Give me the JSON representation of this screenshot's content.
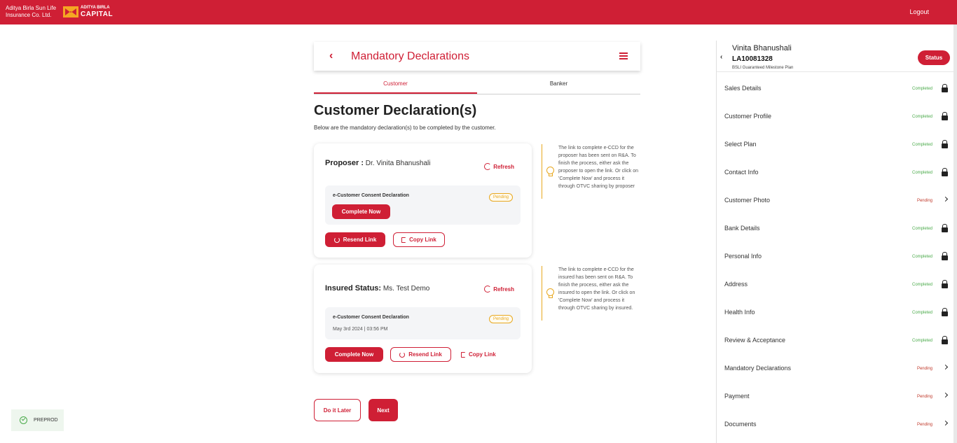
{
  "header": {
    "brand_line1": "Aditya Birla Sun Life",
    "brand_line2": "Insurance Co. Ltd.",
    "logo_top": "ADITYA BIRLA",
    "logo_bottom": "CAPITAL",
    "logout": "Logout",
    "accent_color": "#cf1f35"
  },
  "page": {
    "back_icon": "chevron-left-icon",
    "title": "Mandatory Declarations",
    "menu_icon": "hamburger-menu-icon"
  },
  "tabs": [
    {
      "label": "Customer",
      "active": true
    },
    {
      "label": "Banker",
      "active": false
    }
  ],
  "main": {
    "title": "Customer Declaration(s)",
    "subtitle": "Below are the mandatory declaration(s) to be completed by the customer."
  },
  "cards": [
    {
      "label": "Proposer :",
      "value": " Dr. Vinita Bhanushali",
      "refresh": "Refresh",
      "declaration": "e-Customer Consent Declaration",
      "badge": "Pending",
      "complete_now": "Complete Now",
      "resend_link": "Resend Link",
      "copy_link": "Copy Link",
      "hint": "The link to complete e-CCD for the proposer has been sent on R&A. To finish the process, either ask the proposer to open the link. Or click on 'Complete Now' and process it through OTVC sharing by proposer"
    },
    {
      "label": "Insured Status:",
      "value": " Ms. Test Demo",
      "refresh": "Refresh",
      "declaration": "e-Customer Consent Declaration",
      "date": "May 3rd 2024 | 03:56 PM",
      "badge": "Pending",
      "complete_now": "Complete Now",
      "resend_link": "Resend Link",
      "copy_link": "Copy Link",
      "hint": "The link to complete e-CCD for the insured has been sent on R&A. To finish the process, either ask the insured to open the link. Or click on 'Complete Now' and process it through OTVC sharing by insured."
    }
  ],
  "footer": {
    "do_later": "Do it Later",
    "next": "Next"
  },
  "env": {
    "label": "PREPROD"
  },
  "panel": {
    "name": "Vinita Bhanushali",
    "app_no": "LA10081328",
    "plan": "BSLI Guaranteed Milestone Plan",
    "status_btn": "Status",
    "steps": [
      {
        "label": "Sales Details",
        "status": "Completed"
      },
      {
        "label": "Customer Profile",
        "status": "Completed"
      },
      {
        "label": "Select Plan",
        "status": "Completed"
      },
      {
        "label": "Contact Info",
        "status": "Completed"
      },
      {
        "label": "Customer Photo",
        "status": "Pending"
      },
      {
        "label": "Bank Details",
        "status": "Completed"
      },
      {
        "label": "Personal Info",
        "status": "Completed"
      },
      {
        "label": "Address",
        "status": "Completed"
      },
      {
        "label": "Health Info",
        "status": "Completed"
      },
      {
        "label": "Review & Acceptance",
        "status": "Completed"
      },
      {
        "label": "Mandatory Declarations",
        "status": "Pending"
      },
      {
        "label": "Payment",
        "status": "Pending"
      },
      {
        "label": "Documents",
        "status": "Pending"
      }
    ]
  }
}
